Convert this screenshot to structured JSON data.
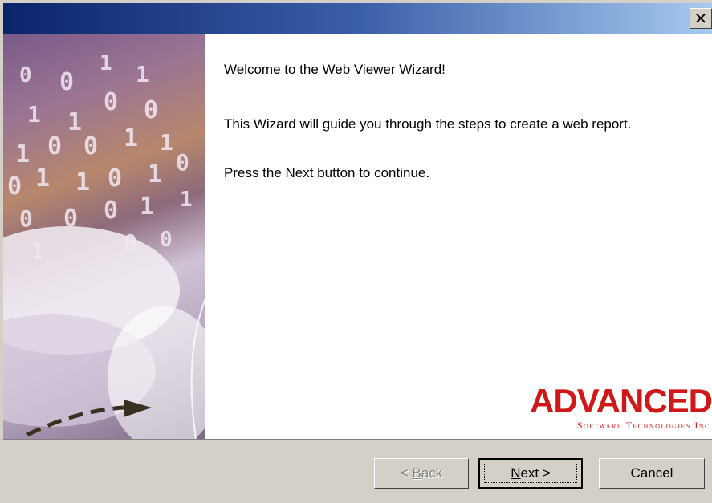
{
  "window": {
    "close_icon": "close-icon"
  },
  "content": {
    "welcome": "Welcome to the Web Viewer Wizard!",
    "description": "This Wizard will guide you through the steps to create a web report.",
    "instruction": "Press the Next button to continue."
  },
  "logo": {
    "name": "ADVANCED",
    "tagline": "Software Technologies Inc"
  },
  "buttons": {
    "back": {
      "prefix": "< ",
      "mnemonic": "B",
      "rest": "ack"
    },
    "next": {
      "mnemonic": "N",
      "rest": "ext >"
    },
    "cancel": "Cancel"
  },
  "colors": {
    "titlebar_start": "#0a246a",
    "titlebar_end": "#a6caf0",
    "logo_red": "#d01818",
    "face": "#d4d0c8"
  }
}
